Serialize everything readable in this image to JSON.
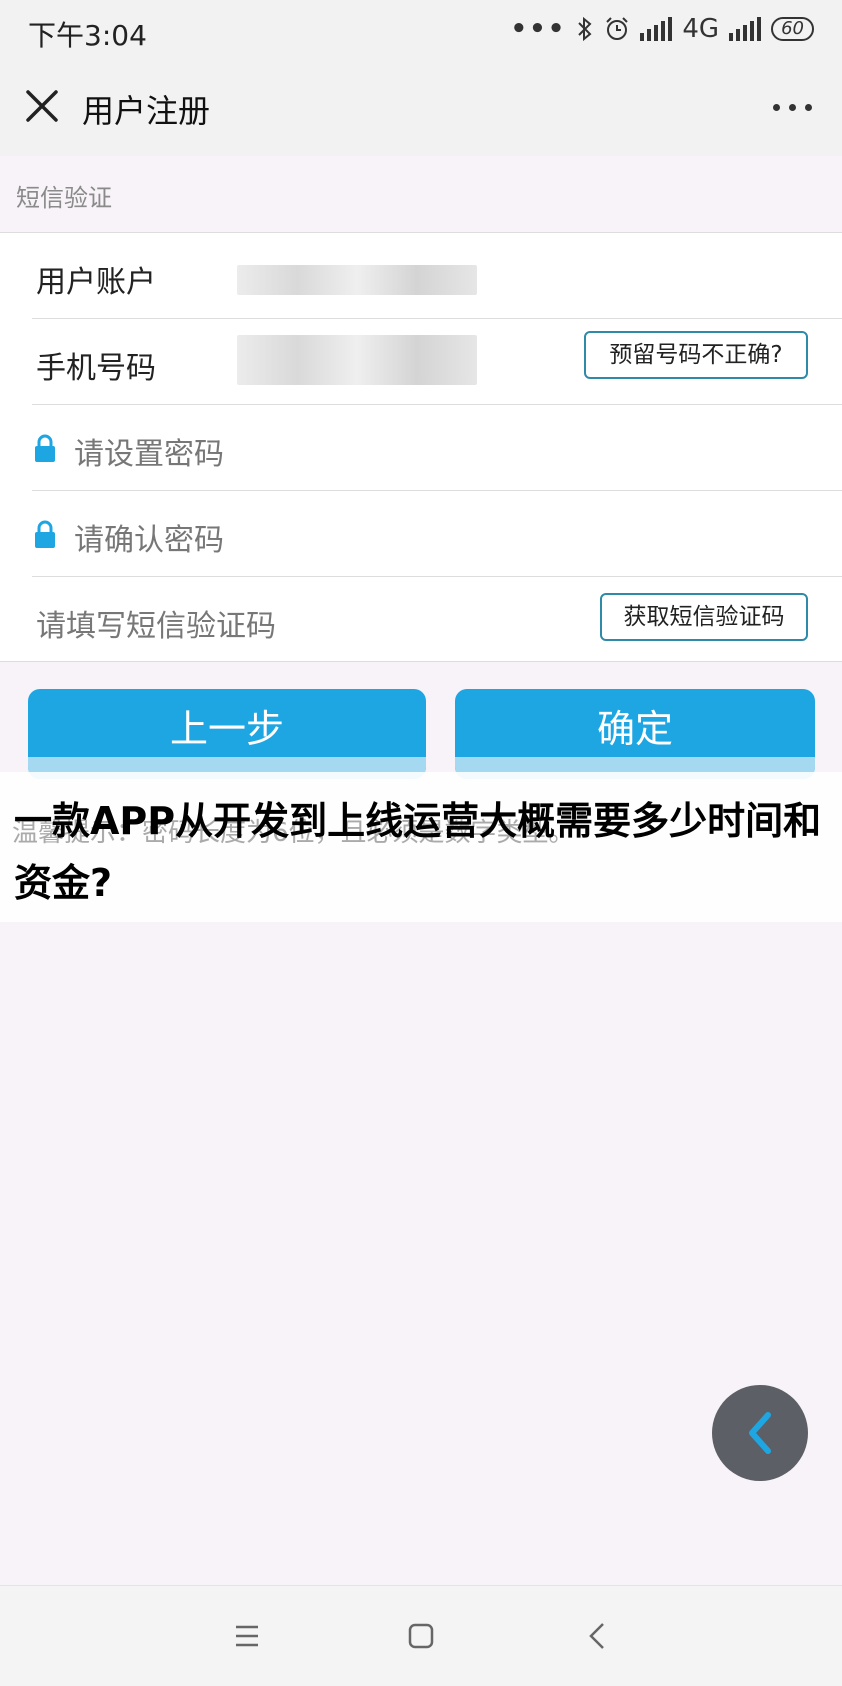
{
  "status_bar": {
    "time": "下午3:04",
    "dots": "•••",
    "network": "4G",
    "battery": "60"
  },
  "header": {
    "title": "用户注册"
  },
  "section": {
    "label": "短信验证"
  },
  "form": {
    "account_label": "用户账户",
    "phone_label": "手机号码",
    "phone_wrong_button": "预留号码不正确?",
    "password_placeholder": "请设置密码",
    "confirm_password_placeholder": "请确认密码",
    "sms_code_placeholder": "请填写短信验证码",
    "get_sms_code_button": "获取短信验证码"
  },
  "actions": {
    "prev_label": "上一步",
    "confirm_label": "确定"
  },
  "tip": "温馨提示：密码长度为6位，且必须是数字类型。",
  "overlay": {
    "headline": "一款APP从开发到上线运营大概需要多少时间和资金?"
  },
  "colors": {
    "accent": "#1ea6e3",
    "accent_light": "#a5d9f2",
    "outline": "#2f8aa8",
    "fab": "#5c5f66"
  },
  "icons": {
    "close": "close-icon",
    "more": "more-icon",
    "lock": "lock-icon",
    "back": "chevron-left-icon",
    "nav_menu": "menu-icon",
    "nav_home": "square-icon",
    "nav_back": "back-icon"
  }
}
